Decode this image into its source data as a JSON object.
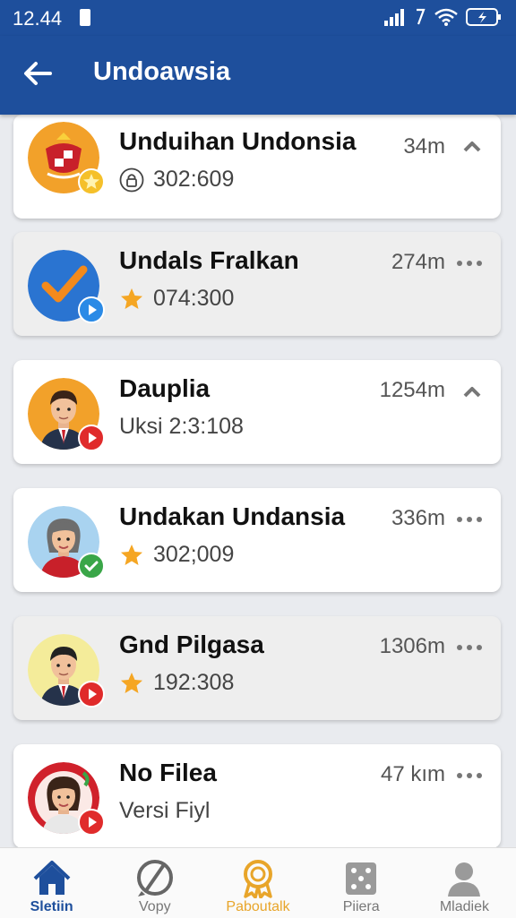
{
  "status": {
    "time": "12.44"
  },
  "header": {
    "title": "Undoawsia"
  },
  "items": [
    {
      "name": "Unduihan Undonsia",
      "sub": "302:609",
      "sub_icon": "lock-icon",
      "distance": "34m",
      "action": "chevron-up-icon",
      "avatar": "coat-of-arms",
      "badge": "star-badge"
    },
    {
      "name": "Undals Fralkan",
      "sub": "074:300",
      "sub_icon": "star-icon",
      "distance": "274m",
      "action": "more-icon",
      "avatar": "checkmark-logo",
      "badge": "play-badge"
    },
    {
      "name": "Dauplia",
      "sub": "Uksi 2:3:108",
      "sub_icon": "",
      "distance": "1254m",
      "action": "chevron-up-icon",
      "avatar": "man-avatar",
      "badge": "play-badge"
    },
    {
      "name": "Undakan Undansia",
      "sub": "302;009",
      "sub_icon": "star-icon",
      "distance": "336m",
      "action": "more-icon",
      "avatar": "woman-avatar",
      "badge": "check-badge"
    },
    {
      "name": "Gnd Pilgasa",
      "sub": "192:308",
      "sub_icon": "star-icon",
      "distance": "1306m",
      "action": "more-icon",
      "avatar": "man-avatar",
      "badge": "play-badge"
    },
    {
      "name": "No Filea",
      "sub": "Versi Fiyl",
      "sub_icon": "",
      "distance": "47 kım",
      "action": "more-icon",
      "avatar": "woman-avatar",
      "badge": "play-badge"
    }
  ],
  "nav": [
    {
      "label": "Sletiin",
      "icon": "home-icon",
      "state": "active"
    },
    {
      "label": "Vopy",
      "icon": "compass-icon",
      "state": ""
    },
    {
      "label": "Paboutalk",
      "icon": "award-icon",
      "state": "gold"
    },
    {
      "label": "Piiera",
      "icon": "dice-icon",
      "state": ""
    },
    {
      "label": "Mladiek",
      "icon": "profile-icon",
      "state": ""
    }
  ],
  "colors": {
    "primary": "#1e4f9c",
    "accent": "#e8a52a",
    "star": "#f5a623",
    "play": "#e02b2b",
    "check": "#3aa648"
  }
}
